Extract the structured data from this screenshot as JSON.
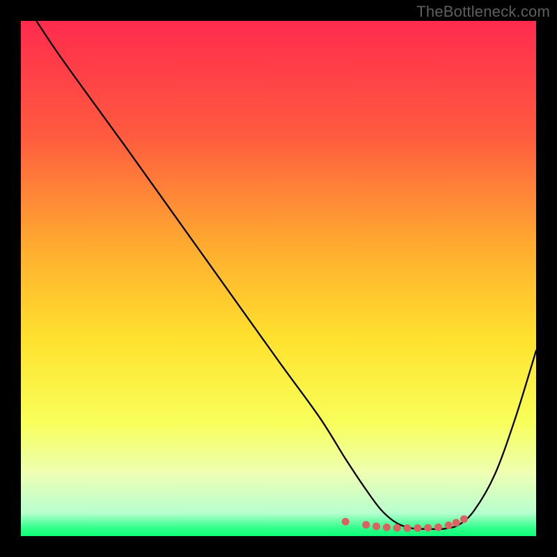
{
  "watermark": "TheBottleneck.com",
  "chart_data": {
    "type": "line",
    "title": "",
    "xlabel": "",
    "ylabel": "",
    "xlim": [
      0,
      100
    ],
    "ylim": [
      0,
      100
    ],
    "gradient_stops": [
      {
        "offset": 0,
        "color": "#ff2b4e"
      },
      {
        "offset": 0.22,
        "color": "#ff5a3f"
      },
      {
        "offset": 0.45,
        "color": "#ffb02f"
      },
      {
        "offset": 0.62,
        "color": "#ffe22e"
      },
      {
        "offset": 0.78,
        "color": "#f8ff5a"
      },
      {
        "offset": 0.88,
        "color": "#ecffb4"
      },
      {
        "offset": 0.955,
        "color": "#b7ffce"
      },
      {
        "offset": 0.985,
        "color": "#2eff8a"
      },
      {
        "offset": 1.0,
        "color": "#0fff78"
      }
    ],
    "series": [
      {
        "name": "bottleneck-curve",
        "x": [
          3,
          7,
          12,
          20,
          30,
          40,
          50,
          58,
          63,
          67,
          70,
          73,
          76,
          79,
          82,
          85,
          88,
          92,
          96,
          100
        ],
        "y": [
          100,
          94,
          87,
          76,
          62,
          48,
          34,
          23,
          15,
          9,
          5,
          2.5,
          1.5,
          1.4,
          1.4,
          2.2,
          5,
          12,
          23,
          36
        ]
      }
    ],
    "optimal_markers": {
      "name": "optimal-range-dots",
      "x": [
        63,
        67,
        69,
        71,
        73,
        75,
        77,
        79,
        81,
        83,
        84.5,
        86
      ],
      "y": [
        2.8,
        2.2,
        1.9,
        1.7,
        1.6,
        1.55,
        1.55,
        1.6,
        1.7,
        2.1,
        2.6,
        3.3
      ]
    }
  }
}
